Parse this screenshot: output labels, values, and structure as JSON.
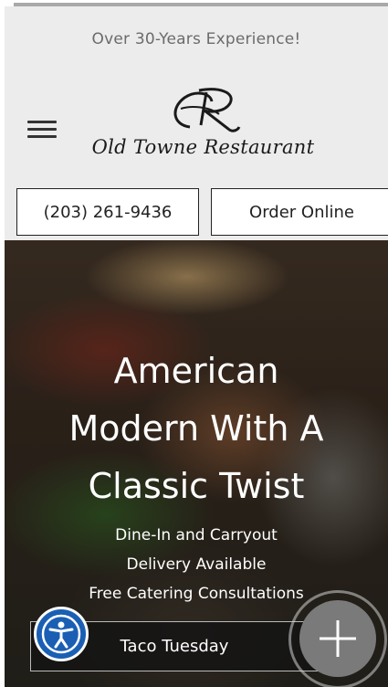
{
  "header": {
    "tagline": "Over 30-Years Experience!",
    "logo_text": "Old Towne Restaurant",
    "phone_label": "(203) 261-9436",
    "order_label": "Order Online"
  },
  "hero": {
    "title_line1": "American",
    "title_line2": "Modern With A",
    "title_line3": "Classic Twist",
    "sub1": "Dine-In and Carryout",
    "sub2": "Delivery Available",
    "sub3": "Free Catering Consultations",
    "cta_label": "Taco Tuesday"
  },
  "icons": {
    "menu": "hamburger-menu-icon",
    "accessibility": "accessibility-icon",
    "fab": "plus-icon"
  },
  "colors": {
    "header_bg": "#ececec",
    "accessibility_blue": "#1a5fb4",
    "fab_gray": "#7a7a7a"
  }
}
